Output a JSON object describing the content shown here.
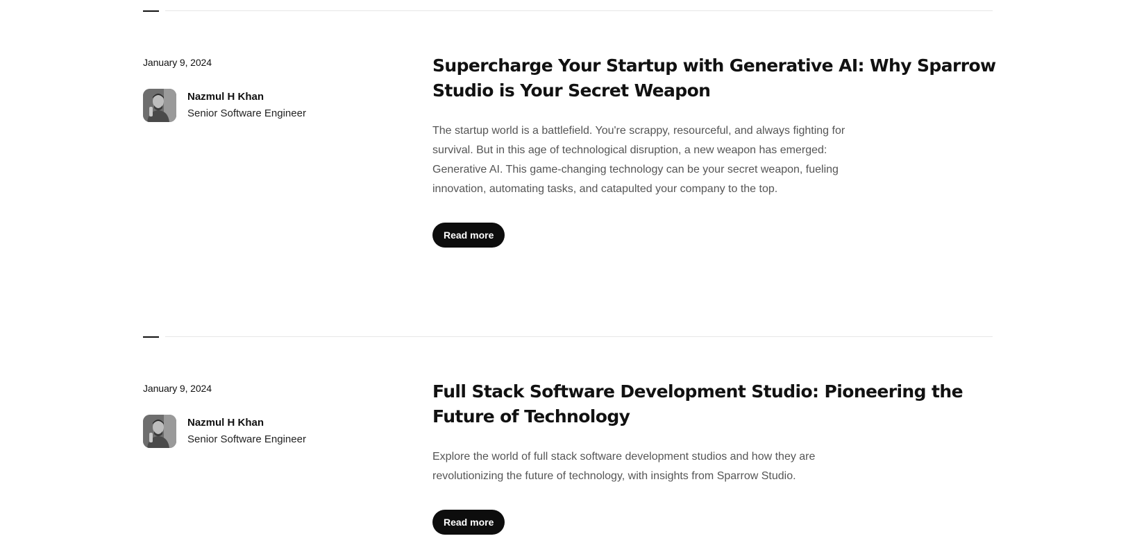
{
  "posts": [
    {
      "date": "January 9, 2024",
      "author_name": "Nazmul H Khan",
      "author_role": "Senior Software Engineer",
      "title": "Supercharge Your Startup with Generative AI: Why Sparrow Studio is Your Secret Weapon",
      "excerpt": "The startup world is a battlefield. You're scrappy, resourceful, and always fighting for survival. But in this age of technological disruption, a new weapon has emerged: Generative AI. This game-changing technology can be your secret weapon, fueling innovation, automating tasks, and catapulted your company to the top.",
      "button_label": "Read more"
    },
    {
      "date": "January 9, 2024",
      "author_name": "Nazmul H Khan",
      "author_role": "Senior Software Engineer",
      "title": "Full Stack Software Development Studio: Pioneering the Future of Technology",
      "excerpt": "Explore the world of full stack software development studios and how they are revolutionizing the future of technology, with insights from Sparrow Studio.",
      "button_label": "Read more"
    }
  ]
}
